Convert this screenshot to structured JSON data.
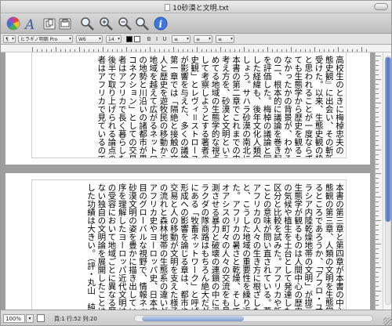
{
  "window": {
    "title": "10砂漠と文明.txt"
  },
  "toolbar": {
    "icons": [
      "color-palette-icon",
      "font-a-icon",
      "copy-icon",
      "paste-icon",
      "zoom-icon",
      "zoom-in-icon",
      "zoom-out-icon",
      "zoom-reset-icon",
      "info-icon"
    ]
  },
  "format": {
    "font_name": "ヒラギノ明朝 Pro",
    "font_weight": "W6",
    "font_size": "14",
    "text_color": "#000000",
    "bg_color": "#ffffff"
  },
  "status": {
    "zoom": "100%",
    "position": "頁:1 行:52 列:20"
  },
  "page1": {
    "columns": [
      "高校生のときに梅棹忠夫の『文明の生",
      "態史観』に出会い、その斬新な切り口に",
      "受けた。以来、生態史観の枠組みを意識",
      "と思われることが一度ならずある。そう",
      "ても生態学から歴史を観ることができ",
      "なかったかの背景が、わかるような気",
      "の二、根本的に議論を巻き起こした著",
      "を評価した。梅棹の議論と同じように",
      "した経緯も、後年文化人類学への転向",
      "しょう。サハラ砂漠の南北における歴",
      "本書の第二章でこれまでの史論を概観",
      "考え方を、砂漠と文明という観点から",
      "めてる地域の生態学的な視点から構成",
      "して考察しようとする著者の議論の",
      "史観」とレヴィ＝ストロースの構造人類",
      "が影響を与えた、多くの議論の先駆け",
      "第一章では「隔絶と接触の文明論」",
      "人と歴史を遊牧民の移動から捉え直",
      "地域を越えて広がるネットワークの",
      "の地勢と川沿いの諸都市が果たした",
      "コネクション」としての交易ルート",
      "者はアフリカで長く暮らした経験を",
      "後半で取り上げられる論点の数々は",
      "者はアフリカで見ているのである。"
    ]
  },
  "page2": {
    "columns": [
      "本書の第三章と第四章が本書の中心部分",
      "態観の第三章、人類の文明を生態学的",
      "るところであろうか、「アフロ・ユー",
      "ラシア内陸乾燥地帯の文明」が提示され",
      "生態学が観るものは人間中心の歴史と同じ",
      "の気候や植生を土台として発達した文明",
      "区分と比較を試みた。アフリカや新大陸",
      "ことの意味が問い直されている。著者は",
      "アフリカの人々の生き方に根ざした視点",
      "と、こうした地域の重要性を繰り返し強",
      "た。アフリカの暑さと乾燥、そして巨大",
      "オアシスの町々の人々の交流をも見事に",
      "測させる暴力と破壊の連鎖の中に浮かび",
      "ラクダの隊商路はもちろん絶大だが、",
      "にある「牧畜ネットワーク」と呼ばれる",
      "形成への影響を論じる章は、都市や国家",
      "交易と人の移動が文明を支えた様子を描",
      "の流れと森林地帯の生態系の違いが社会",
      "アフリカ史やヨーロッパ史、日本史など",
      "目のグローバルな視野で、情報ネットワ",
      "砂漠文明の姿を豊かに描き出している。",
      "序を理解したヨーロッパ近代文明は、そ",
      "の受容において地域ごとに異なる歴史",
      "ない独自の文明論を展開したことは、世",
      "した功績は大きい。（評・丸山　純）"
    ]
  }
}
